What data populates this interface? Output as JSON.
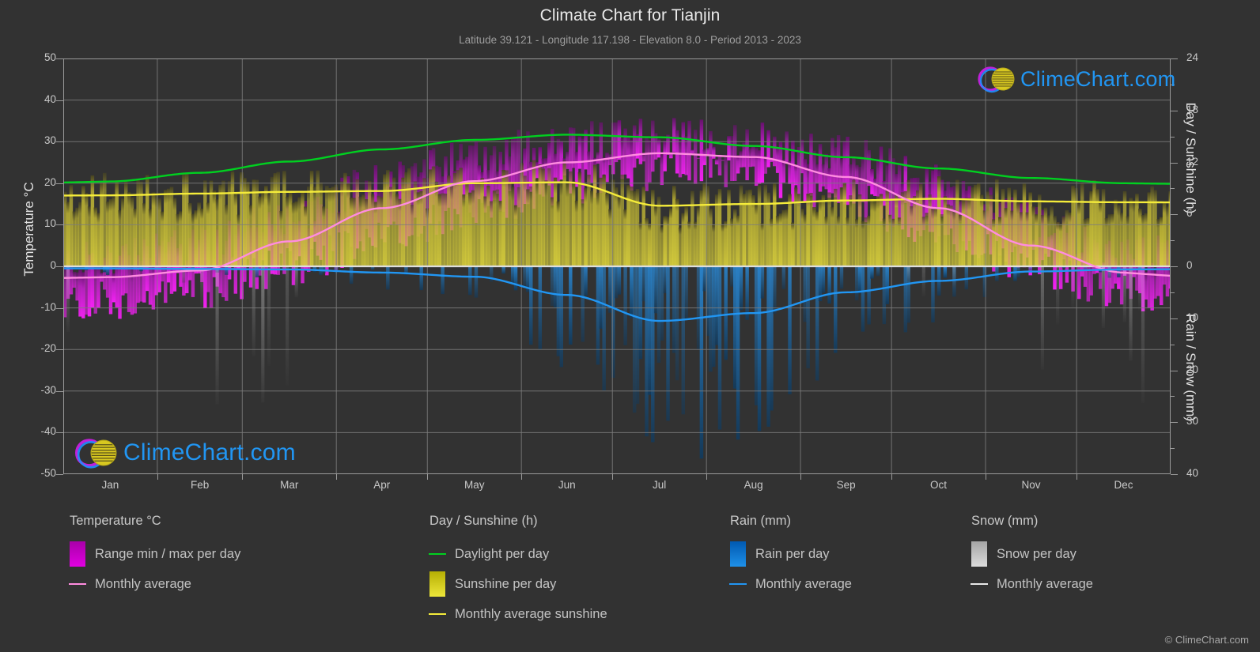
{
  "header": {
    "title": "Climate Chart for Tianjin",
    "subtitle": "Latitude 39.121 - Longitude 117.198 - Elevation 8.0 - Period 2013 - 2023"
  },
  "watermark": {
    "text": "ClimeChart.com"
  },
  "copyright": "© ClimeChart.com",
  "axes": {
    "left_label": "Temperature °C",
    "right_label_top": "Day / Sunshine (h)",
    "right_label_bottom": "Rain / Snow (mm)",
    "left_ticks": [
      "50",
      "40",
      "30",
      "20",
      "10",
      "0",
      "-10",
      "-20",
      "-30",
      "-40",
      "-50"
    ],
    "right_ticks_top": [
      "24",
      "18",
      "12",
      "6",
      "0"
    ],
    "right_ticks_bottom": [
      "10",
      "20",
      "30",
      "40"
    ],
    "x_ticks": [
      "Jan",
      "Feb",
      "Mar",
      "Apr",
      "May",
      "Jun",
      "Jul",
      "Aug",
      "Sep",
      "Oct",
      "Nov",
      "Dec"
    ]
  },
  "legend": {
    "columns": [
      {
        "heading": "Temperature °C",
        "entries": [
          {
            "label": "Range min / max per day",
            "swatch": "box",
            "color": "#e000e0"
          },
          {
            "label": "Monthly average",
            "swatch": "line",
            "color": "#ff8ce0"
          }
        ]
      },
      {
        "heading": "Day / Sunshine (h)",
        "entries": [
          {
            "label": "Daylight per day",
            "swatch": "line",
            "color": "#00d020"
          },
          {
            "label": "Sunshine per day",
            "swatch": "box",
            "color": "#ede63a"
          },
          {
            "label": "Monthly average sunshine",
            "swatch": "line",
            "color": "#f5ec3a"
          }
        ]
      },
      {
        "heading": "Rain (mm)",
        "entries": [
          {
            "label": "Rain per day",
            "swatch": "box",
            "color": "#1e90e8"
          },
          {
            "label": "Monthly average",
            "swatch": "line",
            "color": "#2196f3"
          }
        ]
      },
      {
        "heading": "Snow (mm)",
        "entries": [
          {
            "label": "Snow per day",
            "swatch": "box",
            "color": "#dcdcdc"
          },
          {
            "label": "Monthly average",
            "swatch": "line",
            "color": "#e8e8e8"
          }
        ]
      }
    ]
  },
  "colors": {
    "background": "#323232",
    "grid": "#7d7d7d",
    "axis": "#9a9a9a",
    "text": "#c9c9c9",
    "title": "#eaeaea",
    "temp_range": "#e000e0",
    "temp_avg_line": "#ff8ce0",
    "daylight_line": "#00d020",
    "sunshine_fill": "#cfc53a",
    "sunshine_avg_line": "#f5ec3a",
    "rain_fill": "#1e6fa8",
    "rain_avg_line": "#2196f3",
    "snow_fill": "#9a9a9a",
    "brand_blue": "#2196f3",
    "brand_magenta": "#d020d0",
    "brand_yellow": "#d8d020"
  },
  "chart_data": {
    "type": "area",
    "title": "Climate Chart for Tianjin",
    "subtitle": "Latitude 39.121 - Longitude 117.198 - Elevation 8.0 - Period 2013 - 2023",
    "xlabel": "",
    "ylabel": "Temperature °C",
    "ylabel_right_top": "Day / Sunshine (h)",
    "ylabel_right_bottom": "Rain / Snow (mm)",
    "ylim": [
      -50,
      50
    ],
    "ylim_right_top": [
      0,
      24
    ],
    "ylim_right_bottom": [
      0,
      40
    ],
    "grid": true,
    "legend_position": "below",
    "categories": [
      "Jan",
      "Feb",
      "Mar",
      "Apr",
      "May",
      "Jun",
      "Jul",
      "Aug",
      "Sep",
      "Oct",
      "Nov",
      "Dec"
    ],
    "series": [
      {
        "name": "Monthly average temperature (°C)",
        "unit": "°C",
        "axis": "left",
        "color": "#ff8ce0",
        "values": [
          -2.6,
          -1.0,
          6.0,
          14.0,
          20.5,
          25.0,
          27.2,
          26.3,
          21.5,
          14.0,
          5.0,
          -1.5
        ]
      },
      {
        "name": "Range min per day (°C)",
        "unit": "°C",
        "axis": "left",
        "color": "#e000e0",
        "values": [
          -8.0,
          -6.0,
          0.0,
          7.5,
          14.0,
          19.5,
          23.0,
          22.0,
          16.0,
          8.0,
          0.0,
          -6.5
        ]
      },
      {
        "name": "Range max per day (°C)",
        "unit": "°C",
        "axis": "left",
        "color": "#e000e0",
        "values": [
          2.5,
          5.0,
          12.0,
          20.5,
          27.0,
          30.5,
          31.0,
          30.0,
          27.0,
          20.5,
          11.0,
          3.5
        ]
      },
      {
        "name": "Daylight per day (h)",
        "unit": "h",
        "axis": "right_top",
        "color": "#00d020",
        "values": [
          9.8,
          10.8,
          12.1,
          13.5,
          14.6,
          15.2,
          14.9,
          13.9,
          12.6,
          11.3,
          10.2,
          9.6
        ]
      },
      {
        "name": "Monthly average sunshine (h)",
        "unit": "h",
        "axis": "right_top",
        "color": "#f5ec3a",
        "values": [
          8.2,
          8.4,
          8.6,
          8.7,
          9.6,
          9.7,
          7.0,
          7.2,
          7.6,
          7.8,
          7.5,
          7.4
        ]
      },
      {
        "name": "Monthly average rain (mm)",
        "unit": "mm",
        "axis": "right_bottom",
        "color": "#2196f3",
        "values": [
          0.4,
          0.5,
          0.6,
          1.2,
          2.0,
          5.5,
          10.5,
          9.0,
          5.0,
          2.8,
          1.0,
          0.6
        ]
      }
    ],
    "notes": "Daily min/max temperature range shown as magenta vertical bars; daily sunshine as yellow bars; daily rain as blue downward bars; daily snow as grey downward bars."
  }
}
